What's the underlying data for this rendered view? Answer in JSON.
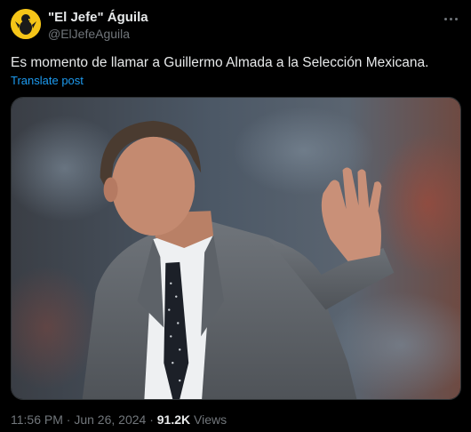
{
  "author": {
    "display_name": "\"El Jefe\" Águila",
    "handle": "@ElJefeAguila",
    "avatar_icon": "eagle-mascot-icon",
    "avatar_color": "#f5c518"
  },
  "more_icon": "more-horizontal-icon",
  "tweet": {
    "text": "Es momento de llamar a Guillermo Almada a la Selección Mexicana.",
    "translate_label": "Translate post"
  },
  "media": {
    "kind": "photo"
  },
  "meta": {
    "time": "11:56 PM",
    "separator": "·",
    "date": "Jun 26, 2024",
    "views_count": "91.2K",
    "views_label": "Views"
  },
  "colors": {
    "background": "#000000",
    "text": "#e7e9ea",
    "muted": "#71767b",
    "link": "#1d9bf0"
  }
}
